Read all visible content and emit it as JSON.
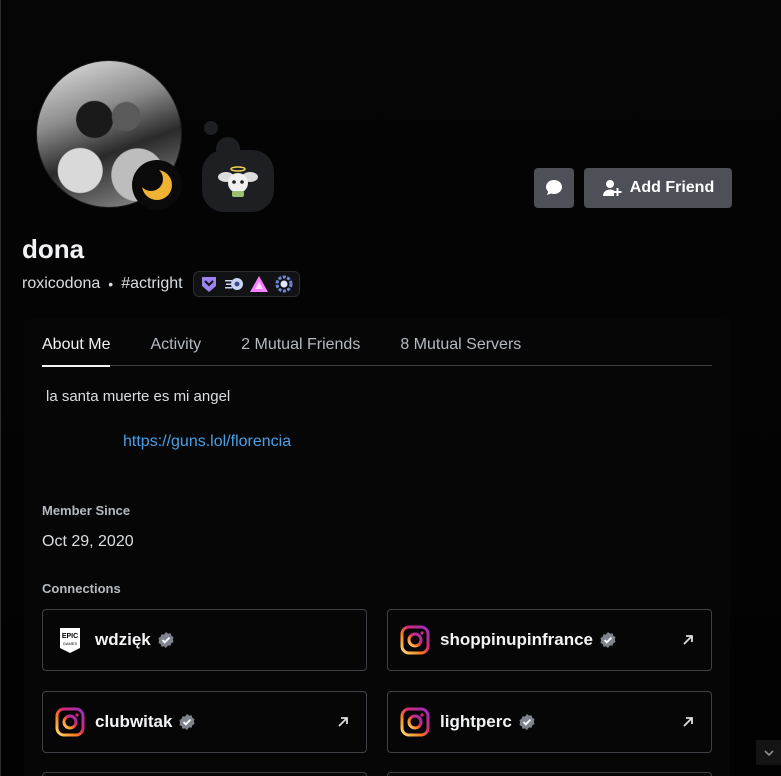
{
  "profile": {
    "display_name": "dona",
    "username": "roxicodona",
    "separator": "•",
    "tag": "#actright",
    "status": "idle",
    "badges": [
      "hypesquad-badge-icon",
      "speedrun-badge-icon",
      "pink-triangle-badge-icon",
      "wreath-badge-icon"
    ]
  },
  "actions": {
    "add_friend_label": "Add Friend",
    "message_icon": "chat-bubble-icon"
  },
  "tabs": [
    {
      "label": "About Me",
      "active": true
    },
    {
      "label": "Activity",
      "active": false
    },
    {
      "label": "2 Mutual Friends",
      "active": false
    },
    {
      "label": "8 Mutual Servers",
      "active": false
    }
  ],
  "about": {
    "bio_line": "la santa muerte es mi angel",
    "link": "https://guns.lol/florencia"
  },
  "member_since": {
    "title": "Member Since",
    "date": "Oct 29, 2020"
  },
  "connections": {
    "title": "Connections",
    "items": [
      {
        "service": "epic-games",
        "name": "wdzięk",
        "verified": true,
        "external": false
      },
      {
        "service": "instagram",
        "name": "shoppinupinfrance",
        "verified": true,
        "external": true
      },
      {
        "service": "instagram",
        "name": "clubwitak",
        "verified": true,
        "external": true
      },
      {
        "service": "instagram",
        "name": "lightperc",
        "verified": true,
        "external": true
      }
    ]
  },
  "colors": {
    "background": "#000000",
    "button": "#4e5058",
    "link": "#4aa0e8",
    "idle": "#f0b232"
  }
}
